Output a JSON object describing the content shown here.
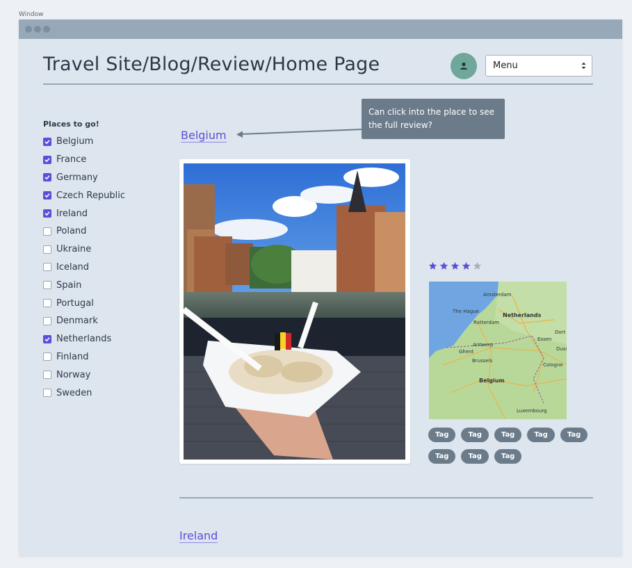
{
  "window": {
    "label": "Window"
  },
  "header": {
    "title": "Travel Site/Blog/Review/Home Page",
    "menu_label": "Menu"
  },
  "sidebar": {
    "title": "Places to go!",
    "places": [
      {
        "label": "Belgium",
        "checked": true
      },
      {
        "label": "France",
        "checked": true
      },
      {
        "label": "Germany",
        "checked": true
      },
      {
        "label": "Czech Republic",
        "checked": true
      },
      {
        "label": "Ireland",
        "checked": true
      },
      {
        "label": "Poland",
        "checked": false
      },
      {
        "label": "Ukraine",
        "checked": false
      },
      {
        "label": "Iceland",
        "checked": false
      },
      {
        "label": "Spain",
        "checked": false
      },
      {
        "label": "Portugal",
        "checked": false
      },
      {
        "label": "Denmark",
        "checked": false
      },
      {
        "label": "Netherlands",
        "checked": true
      },
      {
        "label": "Finland",
        "checked": false
      },
      {
        "label": "Norway",
        "checked": false
      },
      {
        "label": "Sweden",
        "checked": false
      }
    ]
  },
  "main": {
    "first_place_link": "Belgium",
    "callout": "Can click into the place to see the full review?",
    "rating": 4,
    "rating_max": 5,
    "map_labels": [
      "Amsterdam",
      "The Hague",
      "Rotterdam",
      "Netherlands",
      "Dort",
      "Antwerp",
      "Essen",
      "Ghent",
      "Brussels",
      "Duss",
      "Cologne",
      "Belgium",
      "Luxembourg"
    ],
    "tags": [
      "Tag",
      "Tag",
      "Tag",
      "Tag",
      "Tag",
      "Tag",
      "Tag",
      "Tag"
    ],
    "second_place_link": "Ireland"
  },
  "colors": {
    "accent": "#5b4fd8",
    "avatar": "#6fa79a",
    "tag": "#6b7b8a",
    "rule": "#97a8b8",
    "background": "#dde5ee"
  }
}
